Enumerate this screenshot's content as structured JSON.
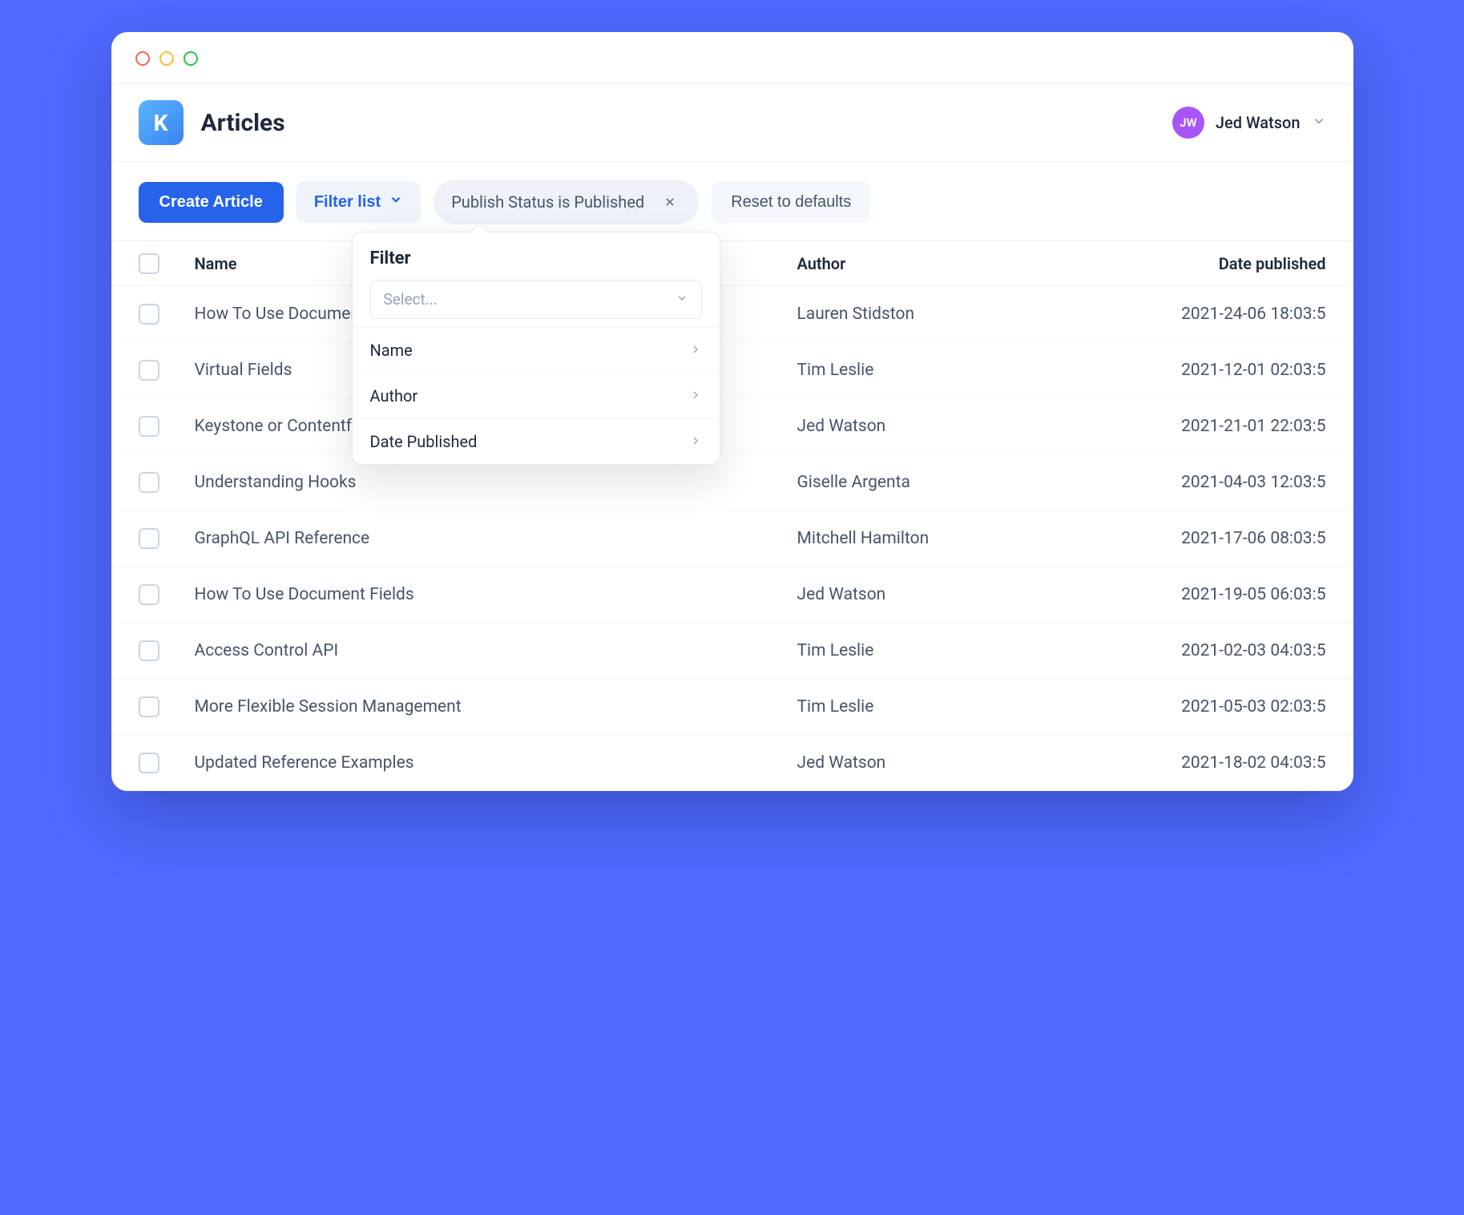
{
  "header": {
    "logo_letter": "K",
    "title": "Articles",
    "user": {
      "initials": "JW",
      "name": "Jed Watson"
    }
  },
  "toolbar": {
    "create_label": "Create Article",
    "filter_label": "Filter list",
    "filter_chip": "Publish Status is Published",
    "reset_label": "Reset to defaults"
  },
  "table": {
    "columns": {
      "name": "Name",
      "author": "Author",
      "date": "Date published"
    },
    "rows": [
      {
        "name": "How To Use Document Followers",
        "author": "Lauren Stidston",
        "date": "2021-24-06 18:03:5"
      },
      {
        "name": "Virtual Fields",
        "author": "Tim Leslie",
        "date": "2021-12-01 02:03:5"
      },
      {
        "name": "Keystone or Contentful — Which One?",
        "author": "Jed Watson",
        "date": "2021-21-01 22:03:5"
      },
      {
        "name": "Understanding Hooks",
        "author": "Giselle Argenta",
        "date": "2021-04-03 12:03:5"
      },
      {
        "name": "GraphQL API Reference",
        "author": "Mitchell Hamilton",
        "date": "2021-17-06 08:03:5"
      },
      {
        "name": "How To Use Document Fields",
        "author": "Jed Watson",
        "date": "2021-19-05 06:03:5"
      },
      {
        "name": "Access Control API",
        "author": "Tim Leslie",
        "date": "2021-02-03 04:03:5"
      },
      {
        "name": "More Flexible Session Management",
        "author": "Tim Leslie",
        "date": "2021-05-03 02:03:5"
      },
      {
        "name": "Updated Reference Examples",
        "author": "Jed Watson",
        "date": "2021-18-02 04:03:5"
      }
    ]
  },
  "popover": {
    "title": "Filter",
    "select_placeholder": "Select...",
    "options": [
      "Name",
      "Author",
      "Date Published"
    ]
  }
}
